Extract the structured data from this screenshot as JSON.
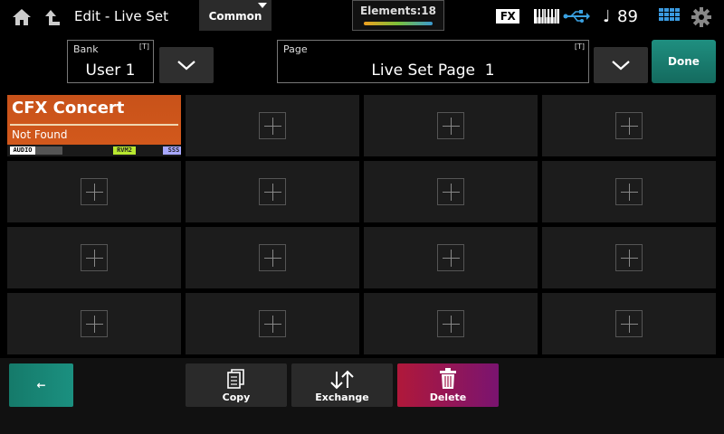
{
  "header": {
    "title": "Edit - Live Set",
    "common_tab": "Common",
    "elements_label": "Elements:18",
    "fx_label": "FX",
    "tempo_symbol": "♩",
    "tempo_value": "89",
    "icons": [
      "home-icon",
      "up-arrow-icon",
      "keyboard-icon",
      "usb-icon",
      "grid-icon",
      "gear-icon"
    ]
  },
  "selectors": {
    "bank": {
      "label": "Bank",
      "tag": "[T]",
      "value": "User 1"
    },
    "page": {
      "label": "Page",
      "tag": "[T]",
      "value": "Live Set Page  1"
    },
    "done_label": "Done"
  },
  "slots": [
    {
      "name": "CFX Concert",
      "status": "Not Found",
      "tags": {
        "audio": "AUDIO",
        "rvm": "RVM2",
        "sss": "SSS"
      }
    }
  ],
  "empty_slot_count": 15,
  "footer": {
    "back_label": "←",
    "copy_label": "Copy",
    "exchange_label": "Exchange",
    "delete_label": "Delete"
  },
  "colors": {
    "filled_slot": "#d45a1c",
    "done": "#1f8f80",
    "delete_start": "#b0183a",
    "delete_end": "#7a1470",
    "back": "#1b9080"
  }
}
